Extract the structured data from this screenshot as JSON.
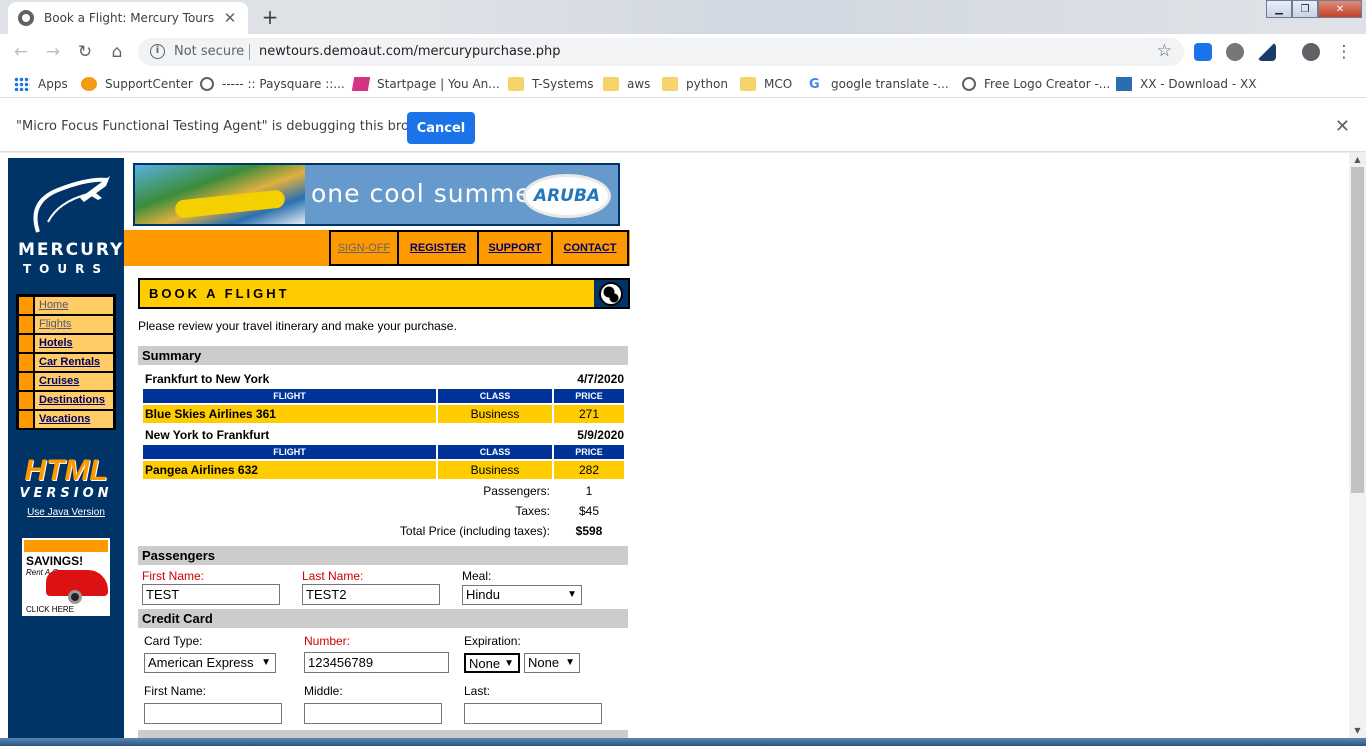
{
  "browser": {
    "tab_title": "Book a Flight: Mercury Tours",
    "security_label": "Not secure",
    "url": "newtours.demoaut.com/mercurypurchase.php",
    "bookmarks": [
      {
        "label": "Apps",
        "icon": "apps-grid-icon"
      },
      {
        "label": "SupportCenter",
        "icon": "supportcenter-icon"
      },
      {
        "label": "----- :: Paysquare ::...",
        "icon": "globe-icon"
      },
      {
        "label": "Startpage | You An...",
        "icon": "startpage-icon"
      },
      {
        "label": "T-Systems",
        "icon": "folder-icon"
      },
      {
        "label": "aws",
        "icon": "folder-icon"
      },
      {
        "label": "python",
        "icon": "folder-icon"
      },
      {
        "label": "MCO",
        "icon": "folder-icon"
      },
      {
        "label": "google translate -...",
        "icon": "google-icon"
      },
      {
        "label": "Free Logo Creator -...",
        "icon": "globe-icon"
      },
      {
        "label": "XX - Download - XX",
        "icon": "xx-icon"
      }
    ],
    "infobar": {
      "message": "\"Micro Focus Functional Testing Agent\" is debugging this browser",
      "cancel_label": "Cancel"
    }
  },
  "site": {
    "logo_line1": "MERCURY",
    "logo_line2": "TOURS",
    "banner_slogan": "one cool summer",
    "banner_brand": "ARUBA",
    "top_links": [
      "SIGN-OFF",
      "REGISTER",
      "SUPPORT",
      "CONTACT"
    ],
    "side_nav": [
      "Home",
      "Flights",
      "Hotels",
      "Car Rentals",
      "Cruises",
      "Destinations",
      "Vacations"
    ],
    "html_version": {
      "line1": "HTML",
      "line2": "VERSION",
      "link": "Use Java Version"
    },
    "ad": {
      "title": "SAVINGS!",
      "subtitle": "Rent A Car",
      "cta": "CLICK HERE"
    }
  },
  "page": {
    "heading": "BOOK A FLIGHT",
    "intro": "Please review your travel itinerary and make your purchase.",
    "summary": {
      "title": "Summary",
      "col_flight": "FLIGHT",
      "col_class": "CLASS",
      "col_price": "PRICE",
      "legs": [
        {
          "route": "Frankfurt to New York",
          "date": "4/7/2020",
          "flight": "Blue Skies Airlines 361",
          "class": "Business",
          "price": "271"
        },
        {
          "route": "New York to Frankfurt",
          "date": "5/9/2020",
          "flight": "Pangea Airlines 632",
          "class": "Business",
          "price": "282"
        }
      ],
      "passengers_label": "Passengers:",
      "passengers_value": "1",
      "taxes_label": "Taxes:",
      "taxes_value": "$45",
      "total_label": "Total Price (including taxes):",
      "total_value": "$598"
    },
    "passengers": {
      "title": "Passengers",
      "first_name_label": "First Name:",
      "first_name_value": "TEST",
      "last_name_label": "Last Name:",
      "last_name_value": "TEST2",
      "meal_label": "Meal:",
      "meal_value": "Hindu"
    },
    "credit_card": {
      "title": "Credit Card",
      "card_type_label": "Card Type:",
      "card_type_value": "American Express",
      "number_label": "Number:",
      "number_value": "123456789",
      "expiration_label": "Expiration:",
      "exp_month": "None",
      "exp_year": "None",
      "first_name_label": "First Name:",
      "middle_label": "Middle:",
      "last_label": "Last:"
    }
  }
}
